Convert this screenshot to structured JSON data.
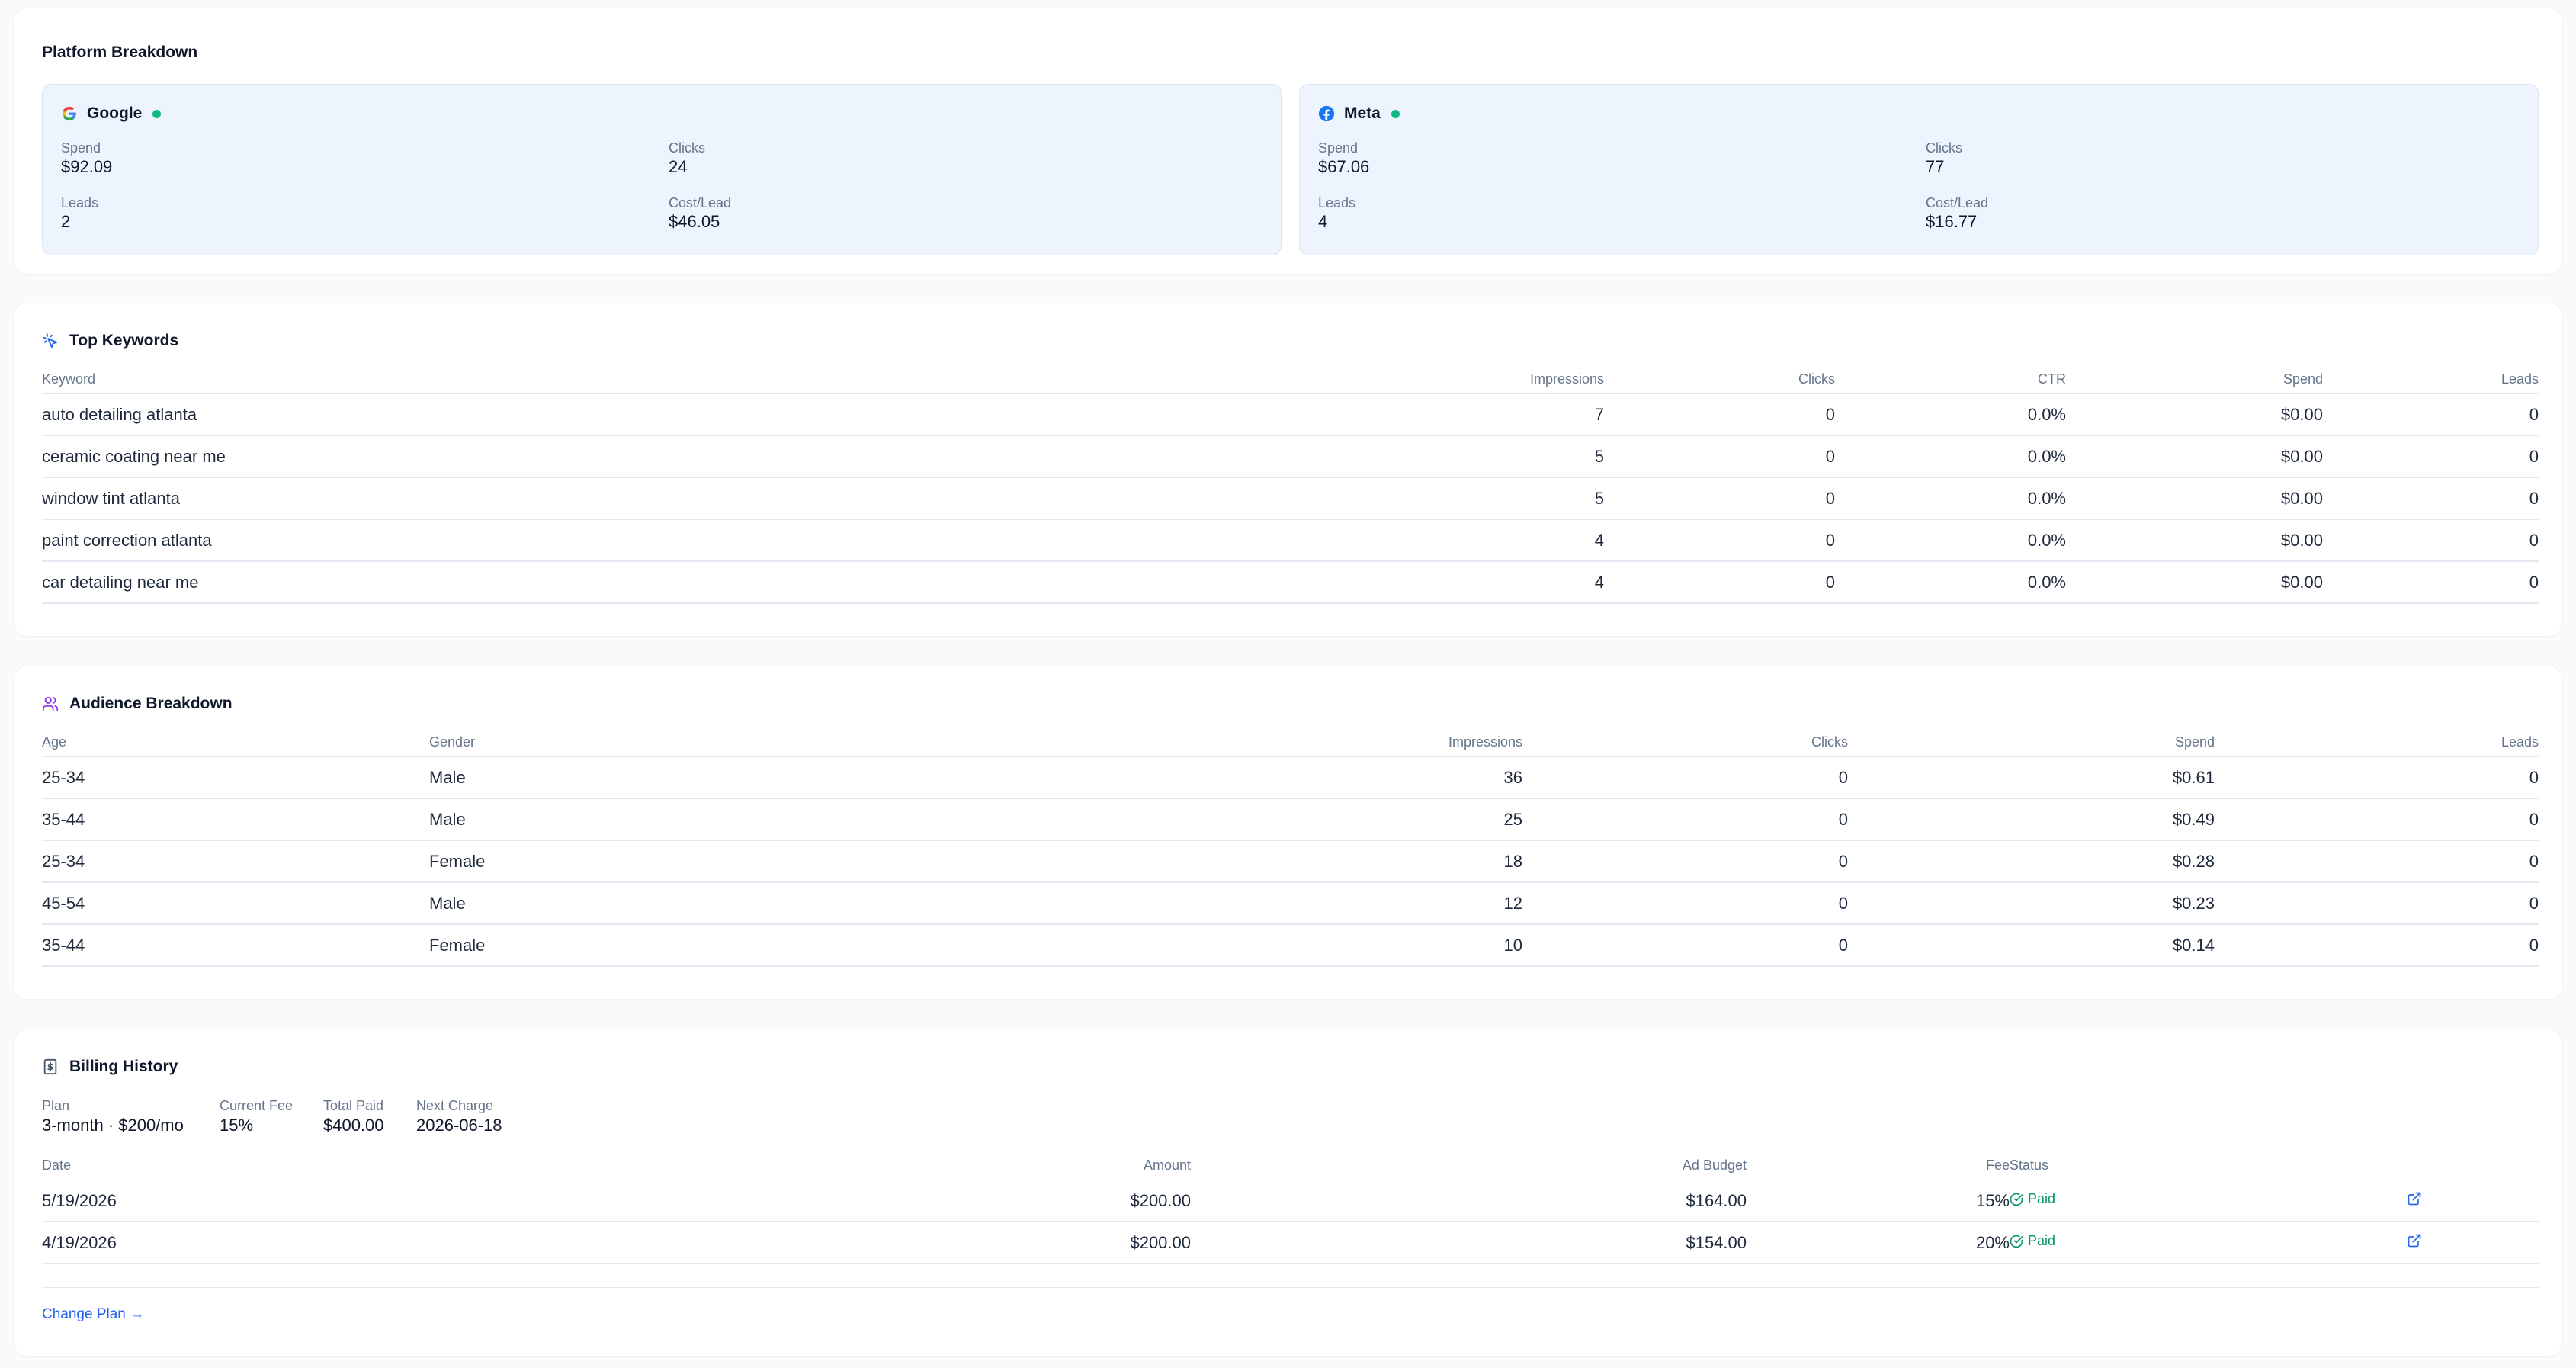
{
  "platform": {
    "title": "Platform Breakdown",
    "cards": [
      {
        "name": "Google",
        "icon": "google-logo-icon",
        "status_color": "#10b981",
        "spend_label": "Spend",
        "spend": "$92.09",
        "clicks_label": "Clicks",
        "clicks": "24",
        "leads_label": "Leads",
        "leads": "2",
        "cpl_label": "Cost/Lead",
        "cpl": "$46.05"
      },
      {
        "name": "Meta",
        "icon": "facebook-logo-icon",
        "status_color": "#10b981",
        "spend_label": "Spend",
        "spend": "$67.06",
        "clicks_label": "Clicks",
        "clicks": "77",
        "leads_label": "Leads",
        "leads": "4",
        "cpl_label": "Cost/Lead",
        "cpl": "$16.77"
      }
    ]
  },
  "keywords": {
    "title": "Top Keywords",
    "headers": [
      "Keyword",
      "Impressions",
      "Clicks",
      "CTR",
      "Spend",
      "Leads"
    ],
    "rows": [
      [
        "auto detailing atlanta",
        "7",
        "0",
        "0.0%",
        "$0.00",
        "0"
      ],
      [
        "ceramic coating near me",
        "5",
        "0",
        "0.0%",
        "$0.00",
        "0"
      ],
      [
        "window tint atlanta",
        "5",
        "0",
        "0.0%",
        "$0.00",
        "0"
      ],
      [
        "paint correction atlanta",
        "4",
        "0",
        "0.0%",
        "$0.00",
        "0"
      ],
      [
        "car detailing near me",
        "4",
        "0",
        "0.0%",
        "$0.00",
        "0"
      ]
    ]
  },
  "audience": {
    "title": "Audience Breakdown",
    "headers": [
      "Age",
      "Gender",
      "Impressions",
      "Clicks",
      "Spend",
      "Leads"
    ],
    "rows": [
      [
        "25-34",
        "Male",
        "36",
        "0",
        "$0.61",
        "0"
      ],
      [
        "35-44",
        "Male",
        "25",
        "0",
        "$0.49",
        "0"
      ],
      [
        "25-34",
        "Female",
        "18",
        "0",
        "$0.28",
        "0"
      ],
      [
        "45-54",
        "Male",
        "12",
        "0",
        "$0.23",
        "0"
      ],
      [
        "35-44",
        "Female",
        "10",
        "0",
        "$0.14",
        "0"
      ]
    ]
  },
  "billing": {
    "title": "Billing History",
    "summary": [
      {
        "label": "Plan",
        "value": "3-month · $200/mo"
      },
      {
        "label": "Current Fee",
        "value": "15%"
      },
      {
        "label": "Total Paid",
        "value": "$400.00"
      },
      {
        "label": "Next Charge",
        "value": "2026-06-18"
      }
    ],
    "headers": [
      "Date",
      "Amount",
      "Ad Budget",
      "Fee",
      "Status"
    ],
    "rows": [
      {
        "date": "5/19/2026",
        "amount": "$200.00",
        "budget": "$164.00",
        "fee": "15%",
        "status": "Paid"
      },
      {
        "date": "4/19/2026",
        "amount": "$200.00",
        "budget": "$154.00",
        "fee": "20%",
        "status": "Paid"
      }
    ],
    "change_plan": "Change Plan →"
  }
}
